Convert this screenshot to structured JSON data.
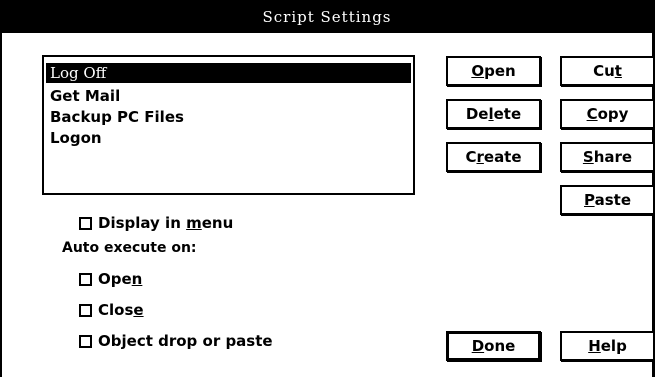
{
  "window": {
    "title": "Script Settings"
  },
  "scripts_list": {
    "items": [
      "Log Off",
      "Get Mail",
      "Backup PC Files",
      "Logon"
    ],
    "selected_index": 0
  },
  "options": {
    "display_in_menu": {
      "label_pre": "Display in ",
      "label_mnemonic": "m",
      "label_post": "enu",
      "checked": false
    },
    "auto_execute_label": "Auto execute on:",
    "open": {
      "label_pre": "Ope",
      "label_mnemonic": "n",
      "label_post": "",
      "checked": false
    },
    "close": {
      "label_pre": "Clos",
      "label_mnemonic": "e",
      "label_post": "",
      "checked": false
    },
    "object_drop": {
      "label_pre": "Ob",
      "label_mnemonic": "j",
      "label_post": "ect drop or paste",
      "checked": false
    }
  },
  "buttons": {
    "open": {
      "pre": "",
      "mnemonic": "O",
      "post": "pen"
    },
    "delete": {
      "pre": "De",
      "mnemonic": "l",
      "post": "ete"
    },
    "create": {
      "pre": "C",
      "mnemonic": "r",
      "post": "eate"
    },
    "cut": {
      "pre": "Cu",
      "mnemonic": "t",
      "post": ""
    },
    "copy": {
      "pre": "",
      "mnemonic": "C",
      "post": "opy"
    },
    "share": {
      "pre": "",
      "mnemonic": "S",
      "post": "hare"
    },
    "paste": {
      "pre": "",
      "mnemonic": "P",
      "post": "aste"
    },
    "done": {
      "pre": "",
      "mnemonic": "D",
      "post": "one"
    },
    "help": {
      "pre": "",
      "mnemonic": "H",
      "post": "elp"
    }
  }
}
